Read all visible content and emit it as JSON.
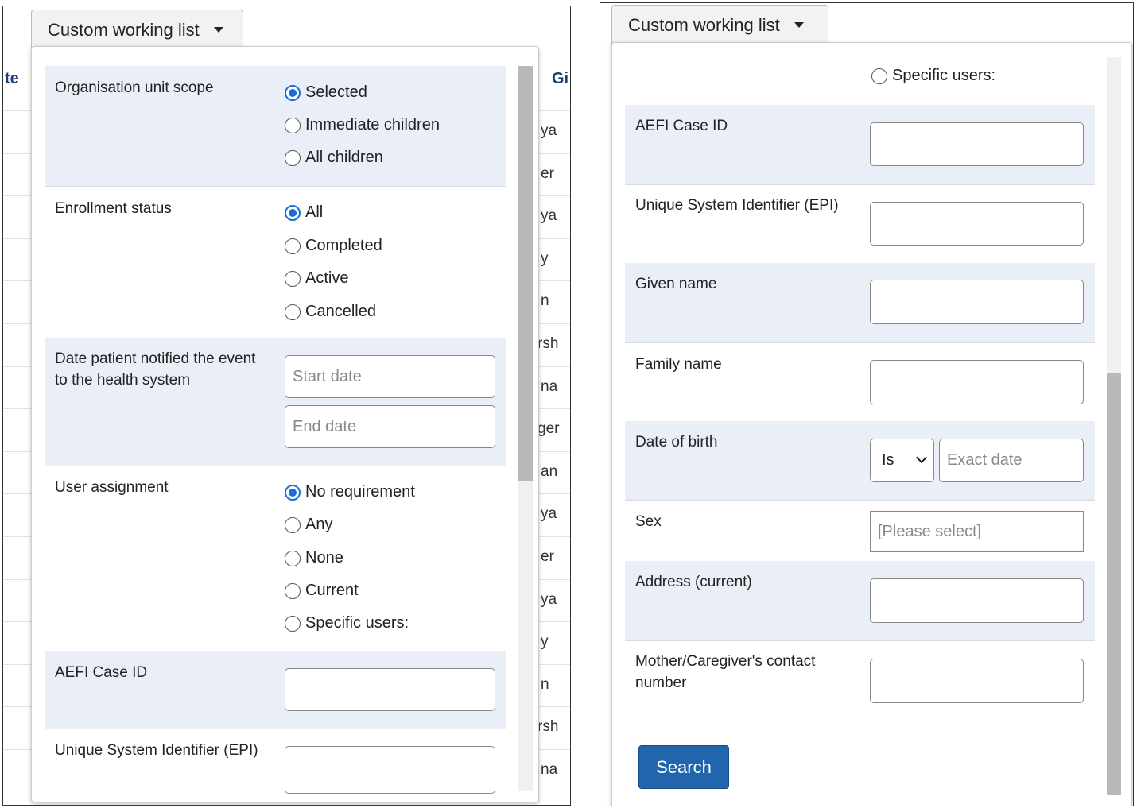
{
  "left": {
    "tab_label": "Custom working list",
    "bg_header_left": "te",
    "bg_header_right": "Gi",
    "bg_cells": [
      "ya",
      "er",
      "ya",
      "y",
      "n",
      "rsh",
      "na",
      "ger",
      "an",
      "ya",
      "er",
      "ya",
      "y",
      "n",
      "rsh",
      "na"
    ],
    "org_unit": {
      "label": "Organisation unit scope",
      "options": [
        "Selected",
        "Immediate children",
        "All children"
      ],
      "selected": "Selected"
    },
    "enrollment": {
      "label": "Enrollment status",
      "options": [
        "All",
        "Completed",
        "Active",
        "Cancelled"
      ],
      "selected": "All"
    },
    "date_notified": {
      "label_line1": "Date patient notified the event",
      "label_line2": "to the health system",
      "start_placeholder": "Start date",
      "end_placeholder": "End date"
    },
    "user_assignment": {
      "label": "User assignment",
      "options": [
        "No requirement",
        "Any",
        "None",
        "Current",
        "Specific users:"
      ],
      "selected": "No requirement"
    },
    "aefi_label": "AEFI Case ID",
    "usi_label": "Unique System Identifier (EPI)"
  },
  "right": {
    "tab_label": "Custom working list",
    "specific_users": "Specific users:",
    "fields": {
      "aefi": "AEFI Case ID",
      "usi": "Unique System Identifier (EPI)",
      "given": "Given name",
      "family": "Family name",
      "dob": "Date of birth",
      "sex": "Sex",
      "address": "Address (current)",
      "contact_line1": "Mother/Caregiver's contact",
      "contact_line2": "number"
    },
    "dob_operator": "Is",
    "dob_placeholder": "Exact date",
    "sex_placeholder": "[Please select]",
    "search_button": "Search"
  },
  "colors": {
    "accent": "#1a6fd6",
    "button": "#2166ad",
    "row_shade": "#e9eef7"
  }
}
